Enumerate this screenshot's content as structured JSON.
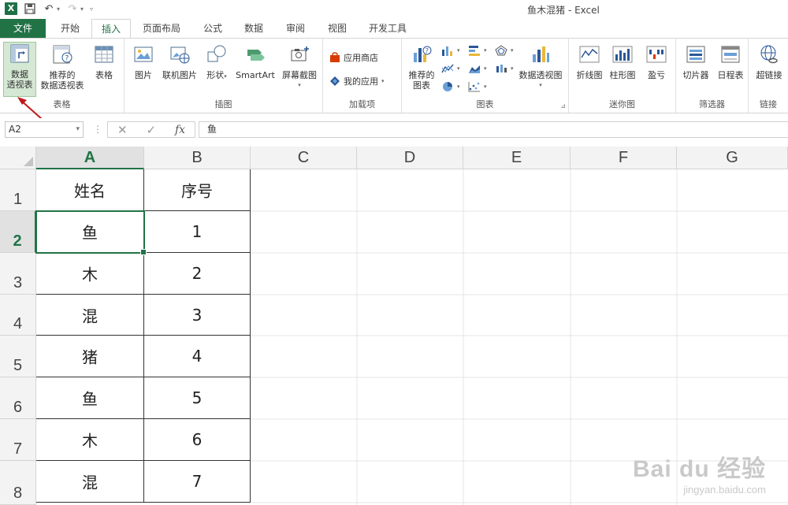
{
  "window": {
    "title": "鱼木混猪 - Excel"
  },
  "qat": {
    "logo": "X"
  },
  "tabs": [
    "文件",
    "开始",
    "插入",
    "页面布局",
    "公式",
    "数据",
    "审阅",
    "视图",
    "开发工具"
  ],
  "ribbon": {
    "groups": {
      "tables": "表格",
      "illustrations": "插图",
      "addins": "加载项",
      "charts": "图表",
      "sparklines": "迷你图",
      "filters": "筛选器",
      "links": "链接"
    },
    "buttons": {
      "pivot_table": [
        "数据",
        "透视表"
      ],
      "recommended_pivot": [
        "推荐的",
        "数据透视表"
      ],
      "table": "表格",
      "pictures": "图片",
      "online_pictures": "联机图片",
      "shapes": "形状",
      "smartart": "SmartArt",
      "screenshot": "屏幕截图",
      "store": "应用商店",
      "my_apps": "我的应用",
      "recommended_charts": [
        "推荐的",
        "图表"
      ],
      "pivot_chart": "数据透视图",
      "line": "折线图",
      "column": "柱形图",
      "win_loss": "盈亏",
      "slicer": "切片器",
      "timeline": "日程表",
      "hyperlink": "超链接"
    }
  },
  "formula_bar": {
    "name_box": "A2",
    "fx": "fx",
    "value": "鱼"
  },
  "sheet": {
    "columns": [
      "A",
      "B",
      "C",
      "D",
      "E",
      "F",
      "G"
    ],
    "rows": [
      "1",
      "2",
      "3",
      "4",
      "5",
      "6",
      "7",
      "8"
    ],
    "cells": [
      [
        "姓名",
        "序号"
      ],
      [
        "鱼",
        "1"
      ],
      [
        "木",
        "2"
      ],
      [
        "混",
        "3"
      ],
      [
        "猪",
        "4"
      ],
      [
        "鱼",
        "5"
      ],
      [
        "木",
        "6"
      ],
      [
        "混",
        "7"
      ]
    ],
    "selected": "A2"
  },
  "watermark": {
    "brand": "Bai du 经验",
    "url": "jingyan.baidu.com"
  },
  "colors": {
    "accent": "#217346",
    "selection": "#217346"
  }
}
